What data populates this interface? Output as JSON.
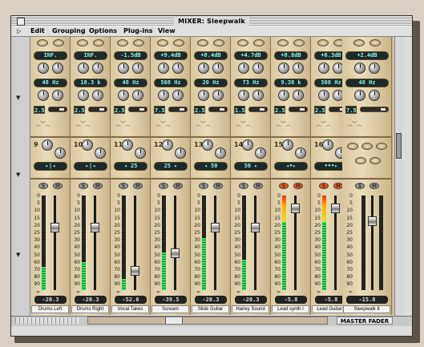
{
  "window": {
    "title": "MIXER: Sleepwalk"
  },
  "menu": [
    "Edit",
    "Grouping",
    "Options",
    "Plug-ins",
    "View"
  ],
  "master_label": "MASTER FADER",
  "strips": [
    {
      "name": "Drums Left",
      "send": "INF.",
      "eqhi": "48 Hz",
      "q": "2.5",
      "insnum": "9",
      "ins": "▸|◂",
      "fader_db": "-20.3",
      "ms_on": false,
      "meter": 0.25,
      "peak": 0
    },
    {
      "name": "Drums Right",
      "send": "INF.",
      "eqhi": "18.3 k",
      "q": "2.5",
      "insnum": "10",
      "ins": "▸|◂",
      "fader_db": "-20.3",
      "ms_on": false,
      "meter": 0.3,
      "peak": 0
    },
    {
      "name": "Vocal Takes",
      "send": "-1.5dB",
      "eqhi": "48 Hz",
      "q": "2.5",
      "insnum": "11",
      "ins": "◂ 25",
      "fader_db": "-52.6",
      "ms_on": false,
      "meter": 0.12,
      "peak": 0
    },
    {
      "name": "Scream",
      "send": "+9.4dB",
      "eqhi": "508 Hz",
      "q": "7.5",
      "insnum": "12",
      "ins": "25 ▸",
      "fader_db": "-39.5",
      "ms_on": false,
      "meter": 0.4,
      "peak": 0
    },
    {
      "name": "Slide Guitar",
      "send": "+8.4dB",
      "eqhi": "20 Hz",
      "q": "2.5",
      "insnum": "13",
      "ins": "◂ 50",
      "fader_db": "-20.3",
      "ms_on": true,
      "meter": 0.55,
      "peak": 0
    },
    {
      "name": "Harley Sound",
      "send": "+4.7dB",
      "eqhi": "73 Hz",
      "q": "1.5",
      "insnum": "14",
      "ins": "50 ▸",
      "fader_db": "-20.3",
      "ms_on": true,
      "meter": 0.32,
      "peak": 0
    },
    {
      "name": "Lead synth I",
      "send": "+8.8dB",
      "eqhi": "9.38 k",
      "q": "2.5",
      "insnum": "15",
      "ins": "◂•▸",
      "fader_db": "-5.8",
      "ms_on": true,
      "meter": 0.92,
      "peak": 1
    },
    {
      "name": "Lead Guitars",
      "send": "+6.3dB",
      "eqhi": "508 Hz",
      "q": "2.5",
      "insnum": "16",
      "ins": "•••▸",
      "fader_db": "-5.8",
      "ms_on": true,
      "meter": 0.85,
      "peak": 1
    },
    {
      "name": "Sleepwalk II",
      "send": "+2.4dB",
      "eqhi": "48 Hz",
      "q": "7.5",
      "insnum": "",
      "ins": "",
      "fader_db": "-15.8",
      "ms_on": false,
      "meter": 0.0,
      "peak": 0
    }
  ],
  "scale": [
    "0",
    "5",
    "10",
    "15",
    "20",
    "25",
    "30",
    "40",
    "50",
    "60",
    "70",
    "80",
    "90",
    "∞"
  ],
  "colors": {
    "panel": "#d9c79f",
    "display": "#8ff2ee",
    "meter_green": "#33e060",
    "peak_red": "#ff2a0a"
  }
}
